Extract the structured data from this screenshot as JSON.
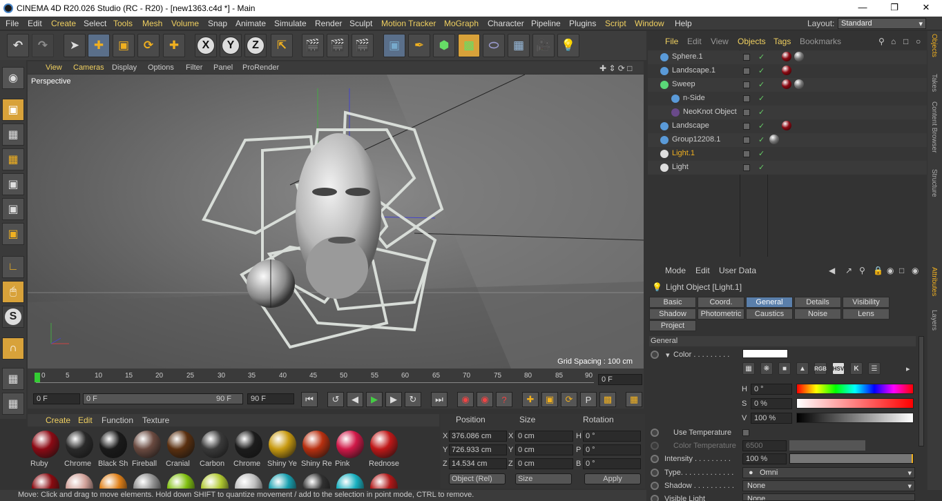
{
  "window": {
    "title": "CINEMA 4D R20.026 Studio (RC - R20) - [new1363.c4d *] - Main"
  },
  "menubar": {
    "items": [
      "File",
      "Edit",
      "Create",
      "Select",
      "Tools",
      "Mesh",
      "Volume",
      "Snap",
      "Animate",
      "Simulate",
      "Render",
      "Sculpt",
      "Motion Tracker",
      "MoGraph",
      "Character",
      "Pipeline",
      "Plugins",
      "Script",
      "Window",
      "Help"
    ],
    "layout_label": "Layout:",
    "layout_value": "Standard"
  },
  "toolbar": {
    "x_label": "X",
    "y_label": "Y",
    "z_label": "Z"
  },
  "viewport": {
    "menu": [
      "View",
      "Cameras",
      "Display",
      "Options",
      "Filter",
      "Panel",
      "ProRender"
    ],
    "label": "Perspective",
    "grid_spacing": "Grid Spacing : 100 cm"
  },
  "timeline": {
    "ticks": [
      "0",
      "5",
      "10",
      "15",
      "20",
      "25",
      "30",
      "35",
      "40",
      "45",
      "50",
      "55",
      "60",
      "65",
      "70",
      "75",
      "80",
      "85",
      "90"
    ],
    "current_frame": "0 F",
    "start_frame": "0 F",
    "range_start": "0 F",
    "range_end": "90 F",
    "end_frame": "90 F"
  },
  "materials": {
    "menu": [
      "Create",
      "Edit",
      "Function",
      "Texture"
    ],
    "items": [
      {
        "name": "Ruby",
        "color": "#8c0a14"
      },
      {
        "name": "Chrome",
        "color": "#2a2a2a"
      },
      {
        "name": "Black Sh",
        "color": "#1a1a1a"
      },
      {
        "name": "Fireball",
        "color": "#6a4a40"
      },
      {
        "name": "Cranial",
        "color": "#5a3010"
      },
      {
        "name": "Carbon",
        "color": "#3a3a3a"
      },
      {
        "name": "Chrome",
        "color": "#1c1c1c"
      },
      {
        "name": "Shiny Ye",
        "color": "#c89a10"
      },
      {
        "name": "Shiny Re",
        "color": "#b83010"
      },
      {
        "name": "Pink",
        "color": "#d01848"
      },
      {
        "name": "Rednose",
        "color": "#c01818"
      }
    ],
    "row2": [
      "#8a0a10",
      "#d0a098",
      "#e08018",
      "#909090",
      "#80c010",
      "#b0c830",
      "#c0c0c0",
      "#18a0b0",
      "#303030",
      "#18b0c0",
      "#b01818"
    ]
  },
  "coords": {
    "headers": {
      "position": "Position",
      "size": "Size",
      "rotation": "Rotation"
    },
    "rows": [
      {
        "axis": "X",
        "pos": "376.086 cm",
        "size": "0 cm",
        "rlabel": "H",
        "rot": "0 °"
      },
      {
        "axis": "Y",
        "pos": "726.933 cm",
        "size": "0 cm",
        "rlabel": "P",
        "rot": "0 °"
      },
      {
        "axis": "Z",
        "pos": "14.534 cm",
        "size": "0 cm",
        "rlabel": "B",
        "rot": "0 °"
      }
    ],
    "mode": "Object (Rel)",
    "size_mode": "Size",
    "apply": "Apply"
  },
  "status": "Move: Click and drag to move elements. Hold down SHIFT to quantize movement / add to the selection in point mode, CTRL to remove.",
  "objects": {
    "menu": [
      "File",
      "Edit",
      "View",
      "Objects",
      "Tags",
      "Bookmarks"
    ],
    "items": [
      {
        "name": "Sphere.1",
        "indent": 0,
        "icon": "#5a9ad8"
      },
      {
        "name": "Landscape.1",
        "indent": 0,
        "icon": "#5a9ad8"
      },
      {
        "name": "Sweep",
        "indent": 0,
        "icon": "#5ad878"
      },
      {
        "name": "n-Side",
        "indent": 1,
        "icon": "#5a9ad8"
      },
      {
        "name": "NeoKnot Object",
        "indent": 1,
        "icon": "#6a4a8a"
      },
      {
        "name": "Landscape",
        "indent": 0,
        "icon": "#5a9ad8"
      },
      {
        "name": "Group12208.1",
        "indent": 0,
        "icon": "#5a9ad8"
      },
      {
        "name": "Light.1",
        "indent": 0,
        "icon": "#dddddd",
        "selected": true
      },
      {
        "name": "Light",
        "indent": 0,
        "icon": "#dddddd"
      }
    ]
  },
  "sidetabs": [
    "Objects",
    "Takes",
    "Content Browser",
    "Structure",
    "Attributes",
    "Layers"
  ],
  "attributes": {
    "menu": [
      "Mode",
      "Edit",
      "User Data"
    ],
    "title": "Light Object [Light.1]",
    "tabs_row1": [
      "Basic",
      "Coord.",
      "General",
      "Details",
      "Visibility"
    ],
    "tabs_row2": [
      "Shadow",
      "Photometric",
      "Caustics",
      "Noise",
      "Lens"
    ],
    "tabs_row3": [
      "Project"
    ],
    "active_tab": "General",
    "section": "General",
    "color_label": "Color . . . . . . . . .",
    "h_label": "H",
    "h_value": "0 °",
    "s_label": "S",
    "s_value": "0 %",
    "v_label": "V",
    "v_value": "100 %",
    "use_temp": "Use Temperature",
    "color_temp": "Color Temperature",
    "color_temp_value": "6500",
    "intensity_label": "Intensity . . . . . . . . .",
    "intensity_value": "100 %",
    "intensity_level": 1.0,
    "type_label": "Type. . . . . . . . . . . . .",
    "type_value": "Omni",
    "shadow_label": "Shadow . . . . . . . . . .",
    "shadow_value": "None",
    "visible_label": "Visible Light",
    "visible_value": "None",
    "colors": {
      "accent": "#f0b020",
      "selected_tab": "#5a7fab"
    }
  }
}
